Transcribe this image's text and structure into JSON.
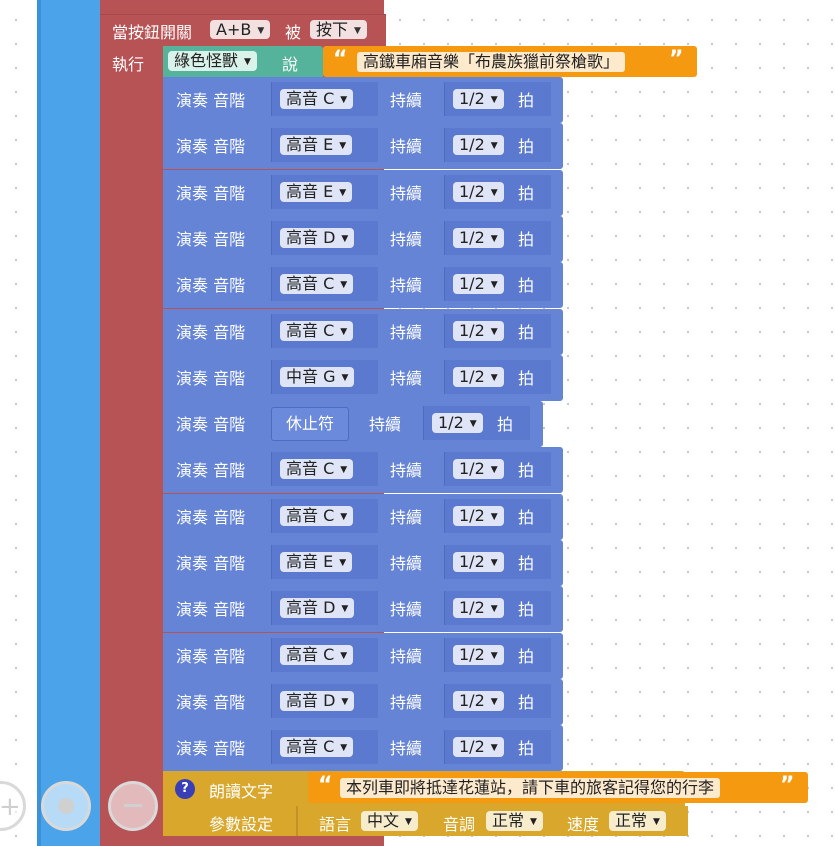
{
  "event": {
    "prefix": "當按鈕開關",
    "button": "A+B",
    "middle": "被",
    "action": "按下",
    "do_label": "執行"
  },
  "say": {
    "monster": "綠色怪獸",
    "verb": "說",
    "text": "高鐵車廂音樂「布農族獵前祭槍歌」"
  },
  "note_labels": {
    "play": "演奏 音階",
    "duration": "持續",
    "beat": "拍"
  },
  "notes": [
    {
      "pitch": "高音 C",
      "duration": "1/2"
    },
    {
      "pitch": "高音 E",
      "duration": "1/2"
    },
    {
      "pitch": "高音 E",
      "duration": "1/2"
    },
    {
      "pitch": "高音 D",
      "duration": "1/2"
    },
    {
      "pitch": "高音 C",
      "duration": "1/2"
    },
    {
      "pitch": "高音 C",
      "duration": "1/2"
    },
    {
      "pitch": "中音 G",
      "duration": "1/2"
    },
    {
      "pitch": "休止符",
      "duration": "1/2",
      "rest": true
    },
    {
      "pitch": "高音 C",
      "duration": "1/2"
    },
    {
      "pitch": "高音 C",
      "duration": "1/2"
    },
    {
      "pitch": "高音 E",
      "duration": "1/2"
    },
    {
      "pitch": "高音 D",
      "duration": "1/2"
    },
    {
      "pitch": "高音 C",
      "duration": "1/2"
    },
    {
      "pitch": "高音 D",
      "duration": "1/2"
    },
    {
      "pitch": "高音 C",
      "duration": "1/2"
    }
  ],
  "speak": {
    "label": "朗讀文字",
    "text": "本列車即將抵達花蓮站，請下車的旅客記得您的行李",
    "settings_label": "參數設定",
    "language_label": "語言",
    "language": "中文",
    "tone_label": "音調",
    "tone": "正常",
    "speed_label": "速度",
    "speed": "正常"
  },
  "colors": {
    "event": "#b75355",
    "outer": "#4ba3ea",
    "say": "#54b39a",
    "string": "#f59a10",
    "note": "#6584d6",
    "speak": "#d8a72c"
  },
  "icons": {
    "quote_open": "“",
    "quote_close": "”",
    "help": "?"
  }
}
